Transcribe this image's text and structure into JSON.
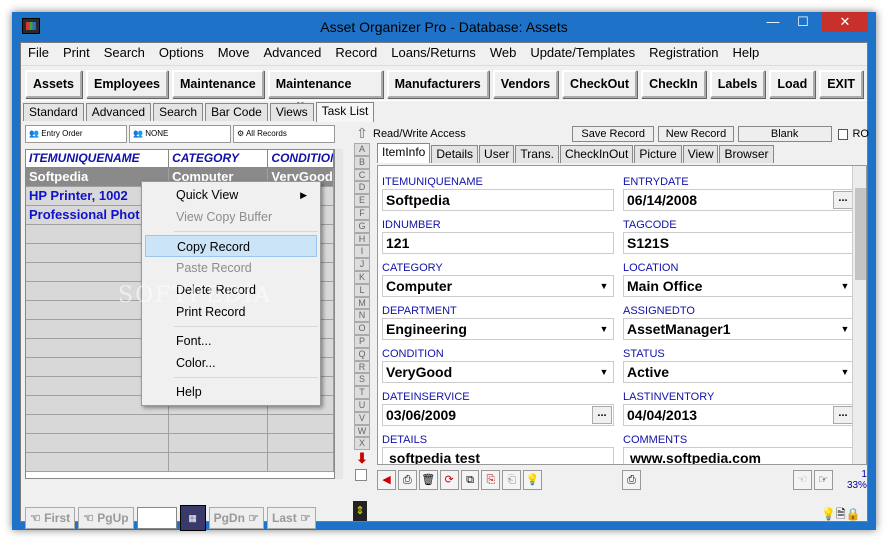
{
  "window": {
    "title": "Asset Organizer Pro - Database: Assets",
    "min": "—",
    "max": "☐",
    "close": "✕"
  },
  "menu": [
    "File",
    "Print",
    "Search",
    "Options",
    "Move",
    "Advanced",
    "Record",
    "Loans/Returns",
    "Web",
    "Update/Templates",
    "Registration",
    "Help"
  ],
  "toolbar": [
    "Assets",
    "Employees",
    "Maintenance",
    "Maintenance Staff",
    "Manufacturers",
    "Vendors",
    "CheckOut",
    "CheckIn",
    "Labels",
    "Load",
    "EXIT"
  ],
  "view_tabs": [
    "Standard",
    "Advanced",
    "Search",
    "Bar Code",
    "Views",
    "Task List"
  ],
  "sort": {
    "s1": "Entry Order",
    "s2": "NONE",
    "s3": "All Records"
  },
  "grid": {
    "headers": [
      "ITEMUNIQUENAME",
      "CATEGORY",
      "CONDITION"
    ],
    "rows": [
      [
        "Softpedia",
        "Computer",
        "VeryGood"
      ],
      [
        "HP Printer, 1002",
        "",
        "od"
      ],
      [
        "Professional Phot",
        "",
        ""
      ]
    ]
  },
  "nav": {
    "first": "First",
    "pgup": "PgUp",
    "pgdn": "PgDn",
    "last": "Last"
  },
  "az": [
    "A",
    "B",
    "C",
    "D",
    "E",
    "F",
    "G",
    "H",
    "I",
    "J",
    "K",
    "L",
    "M",
    "N",
    "O",
    "P",
    "Q",
    "R",
    "S",
    "T",
    "U",
    "V",
    "W",
    "X"
  ],
  "access": {
    "label": "Read/Write Access",
    "save": "Save Record",
    "new": "New Record",
    "blank": "Blank",
    "ro": "RO"
  },
  "rec_tabs": [
    "ItemInfo",
    "Details",
    "User",
    "Trans.",
    "CheckInOut",
    "Picture",
    "View",
    "Browser"
  ],
  "fields": {
    "itemuniquename": {
      "label": "ITEMUNIQUENAME",
      "value": "Softpedia"
    },
    "entrydate": {
      "label": "ENTRYDATE",
      "value": "06/14/2008"
    },
    "idnumber": {
      "label": "IDNUMBER",
      "value": "121"
    },
    "tagcode": {
      "label": "TAGCODE",
      "value": "S121S"
    },
    "category": {
      "label": "CATEGORY",
      "value": "Computer"
    },
    "location": {
      "label": "LOCATION",
      "value": "Main Office"
    },
    "department": {
      "label": "DEPARTMENT",
      "value": "Engineering"
    },
    "assignedto": {
      "label": "ASSIGNEDTO",
      "value": "AssetManager1"
    },
    "condition": {
      "label": "CONDITION",
      "value": "VeryGood"
    },
    "status": {
      "label": "STATUS",
      "value": "Active"
    },
    "dateinservice": {
      "label": "DATEINSERVICE",
      "value": "03/06/2009"
    },
    "lastinventory": {
      "label": "LASTINVENTORY",
      "value": "04/04/2013"
    },
    "details": {
      "label": "DETAILS",
      "value": "softpedia test"
    },
    "comments": {
      "label": "COMMENTS",
      "value": "www.softpedia.com"
    }
  },
  "counter": {
    "n": "1",
    "pct": "33%"
  },
  "context_menu": {
    "items": [
      "Quick View",
      "View Copy Buffer",
      "Copy Record",
      "Paste Record",
      "Delete Record",
      "Print Record",
      "Font...",
      "Color...",
      "Help"
    ]
  },
  "watermark": "SOFTPEDIA"
}
